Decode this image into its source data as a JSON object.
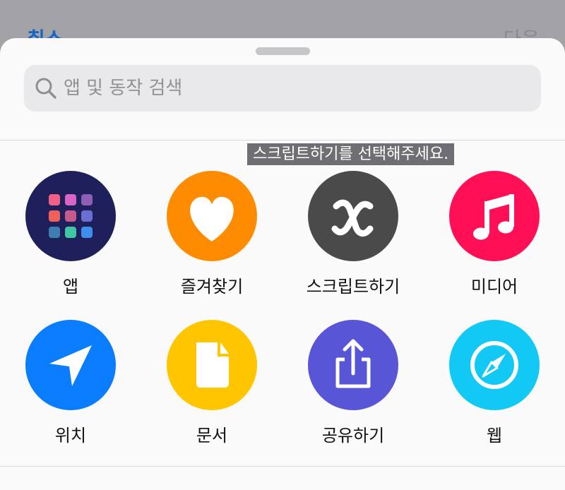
{
  "backdrop": {
    "cancel_label": "취소",
    "next_label": "다음"
  },
  "search": {
    "placeholder": "앱 및 동작 검색",
    "value": ""
  },
  "tooltip": "스크립트하기를 선택해주세요.",
  "categories": [
    {
      "label": "앱",
      "color": "#1f1f5c",
      "icon": "app-grid-icon"
    },
    {
      "label": "즐겨찾기",
      "color": "#ff8c00",
      "icon": "heart-icon"
    },
    {
      "label": "스크립트하기",
      "color": "#4a4a4a",
      "icon": "script-x-icon"
    },
    {
      "label": "미디어",
      "color": "#ff0f55",
      "icon": "music-note-icon"
    },
    {
      "label": "위치",
      "color": "#0a7dff",
      "icon": "location-arrow-icon"
    },
    {
      "label": "문서",
      "color": "#ffc600",
      "icon": "document-icon"
    },
    {
      "label": "공유하기",
      "color": "#5856d6",
      "icon": "share-icon"
    },
    {
      "label": "웹",
      "color": "#12c8f5",
      "icon": "compass-icon"
    }
  ],
  "app_grid_colors": [
    "#f26185",
    "#d865c8",
    "#8f5fb8",
    "#f2605c",
    "#c55a8e",
    "#6b6fd4",
    "#3d7eb1",
    "#3ec7a0",
    "#3e8ef0"
  ]
}
